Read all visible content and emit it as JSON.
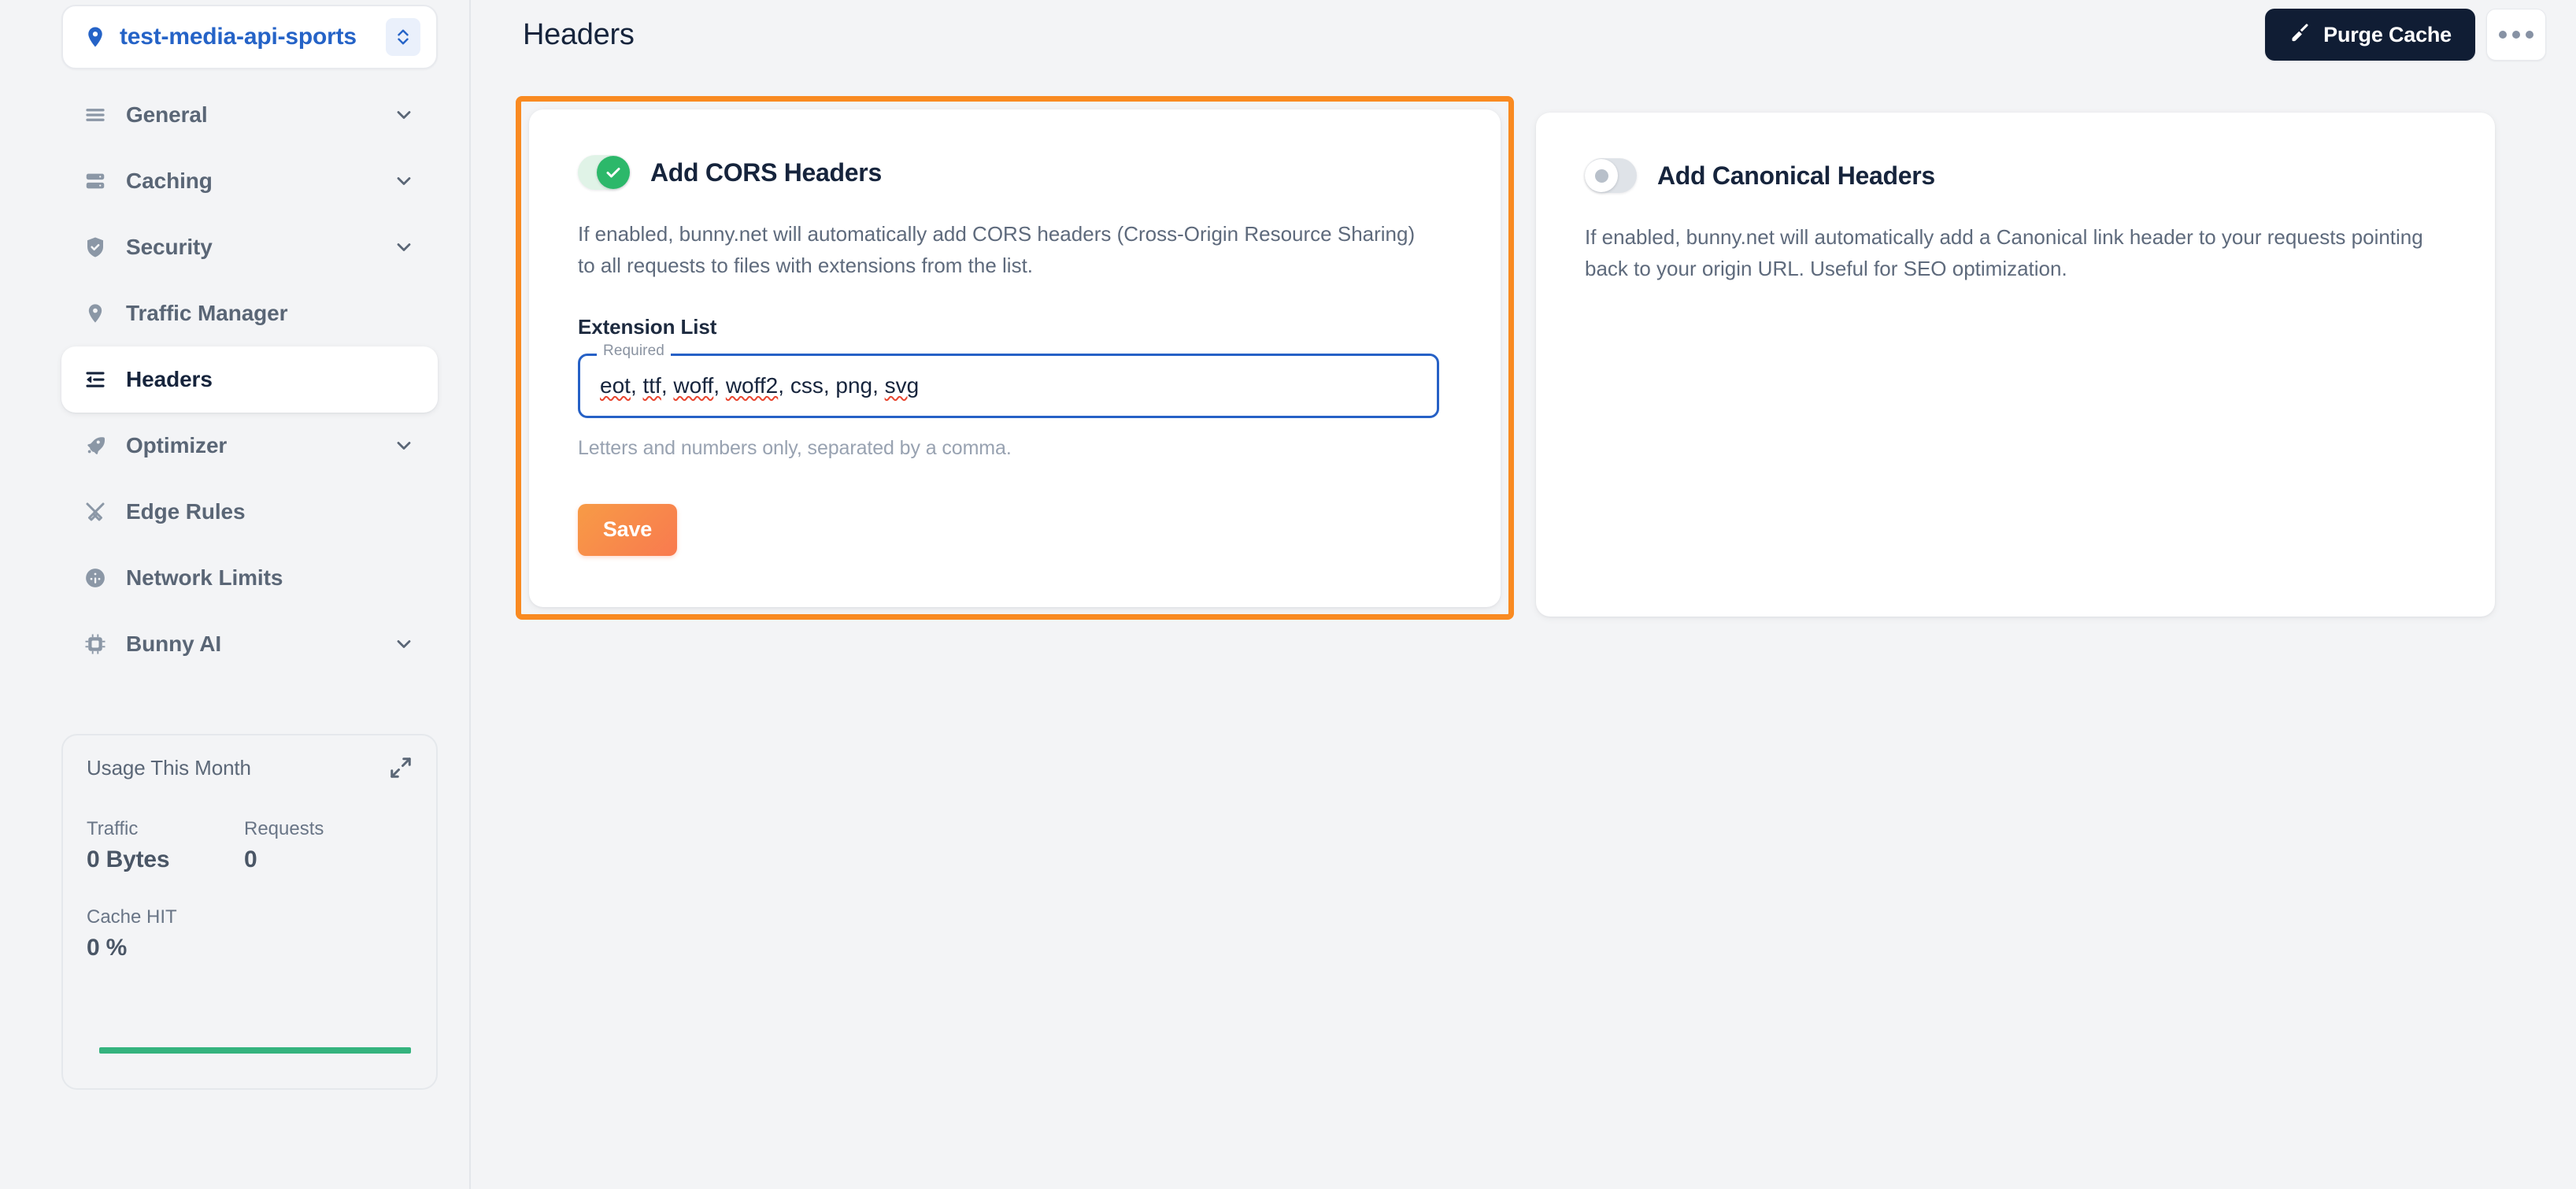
{
  "sidebar": {
    "project": {
      "name": "test-media-api-sports",
      "pin_icon": "location-pin-icon",
      "chevron_icon": "chevron-up-down-icon"
    },
    "items": [
      {
        "label": "General",
        "icon": "menu-lines-icon",
        "expandable": true,
        "active": false
      },
      {
        "label": "Caching",
        "icon": "server-icon",
        "expandable": true,
        "active": false
      },
      {
        "label": "Security",
        "icon": "shield-check-icon",
        "expandable": true,
        "active": false
      },
      {
        "label": "Traffic Manager",
        "icon": "location-pin-icon",
        "expandable": false,
        "active": false
      },
      {
        "label": "Headers",
        "icon": "headers-indent-icon",
        "expandable": false,
        "active": true
      },
      {
        "label": "Optimizer",
        "icon": "rocket-icon",
        "expandable": true,
        "active": false
      },
      {
        "label": "Edge Rules",
        "icon": "tools-icon",
        "expandable": false,
        "active": false
      },
      {
        "label": "Network Limits",
        "icon": "gauge-icon",
        "expandable": false,
        "active": false
      },
      {
        "label": "Bunny AI",
        "icon": "chip-ai-icon",
        "expandable": true,
        "active": false
      }
    ],
    "usage": {
      "title": "Usage This Month",
      "expand_icon": "expand-arrows-icon",
      "stats": [
        {
          "label": "Traffic",
          "value": "0 Bytes"
        },
        {
          "label": "Requests",
          "value": "0"
        },
        {
          "label": "Cache HIT",
          "value": "0 %"
        }
      ],
      "bar_color": "#34b37e"
    }
  },
  "header": {
    "title": "Headers",
    "purge_button": {
      "label": "Purge Cache",
      "icon": "broom-icon"
    },
    "more_button": {
      "icon": "ellipsis-icon"
    }
  },
  "main": {
    "cards": [
      {
        "title": "Add CORS Headers",
        "toggle_state": "on",
        "toggle_icon": "check-icon",
        "description": "If enabled, bunny.net will automatically add CORS headers (Cross-Origin Resource Sharing) to all requests to files with extensions from the list.",
        "field": {
          "label": "Extension List",
          "legend": "Required",
          "value": "eot, ttf, woff, woff2, css, png, svg",
          "help": "Letters and numbers only, separated by a comma."
        },
        "save_label": "Save",
        "highlighted": true
      },
      {
        "title": "Add Canonical Headers",
        "toggle_state": "off",
        "description": "If enabled, bunny.net will automatically add a Canonical link header to your requests pointing back to your origin URL. Useful for SEO optimization.",
        "highlighted": false
      }
    ]
  },
  "colors": {
    "highlight": "#f98a21",
    "accent_blue": "#2563c7",
    "toggle_on": "#2cb86a",
    "dark_button": "#101d34",
    "save_gradient_start": "#f79b46",
    "save_gradient_end": "#f97a4f",
    "page_bg": "#f3f4f6"
  }
}
